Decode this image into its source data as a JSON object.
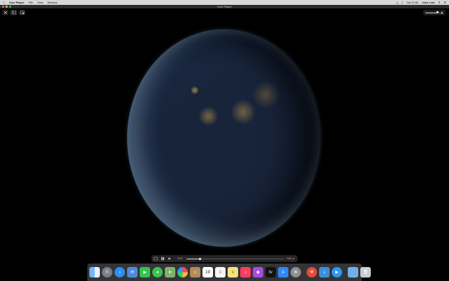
{
  "menubar": {
    "app_name": "Zure Player",
    "menus": [
      "File",
      "View",
      "Window"
    ],
    "clock": "Sat 22:50",
    "user": "José Leal"
  },
  "window": {
    "title": "Zure Player"
  },
  "player": {
    "elapsed": "0:03",
    "remaining": "2:55",
    "progress": 0.14,
    "volume": 0.82
  },
  "dock": {
    "icons": [
      "finder-icon",
      "launchpad-icon",
      "safari-icon",
      "mail-icon",
      "facetime-icon",
      "messages-icon",
      "maps-icon",
      "photos-icon",
      "contacts-icon",
      "calendar-icon",
      "reminders-icon",
      "notes-icon",
      "music-icon",
      "podcasts-icon",
      "tv-icon",
      "app-store-icon",
      "system-preferences-icon",
      "xcode-icon",
      "finder-folder-icon",
      "trash-icon"
    ],
    "calendar_day": "19"
  }
}
